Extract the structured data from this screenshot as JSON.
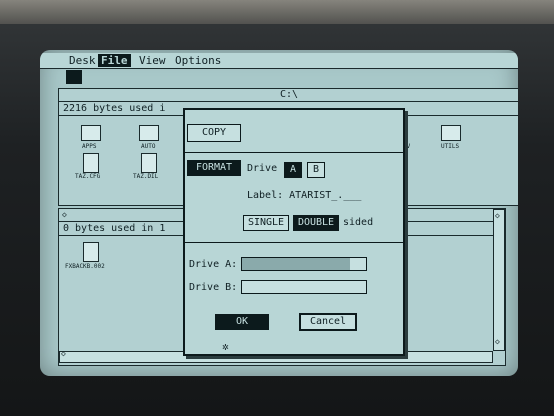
{
  "menu": {
    "desk": "Desk",
    "file": "File",
    "view": "View",
    "options": "Options"
  },
  "window_top": {
    "title": "C:\\",
    "info": "2216 bytes used i",
    "icons": [
      "APPS",
      "AUTO",
      "TAZ.CFG",
      "TAZ.DIL",
      "UTILS"
    ],
    "partial_label": "PV"
  },
  "window_bottom": {
    "info": "0 bytes used in 1",
    "icons": [
      "FXBACKB.002"
    ]
  },
  "dialog": {
    "copy": "COPY",
    "format": "FORMAT",
    "drive_label": "Drive",
    "drive_a": "A",
    "drive_b": "B",
    "label_field": "Label: ATARIST_.___",
    "single": "SINGLE",
    "double": "DOUBLE",
    "sided": "sided",
    "drive_a_progress_label": "Drive A:",
    "drive_b_progress_label": "Drive B:",
    "drive_a_progress": 0.87,
    "drive_b_progress": 0,
    "ok": "OK",
    "cancel": "Cancel"
  }
}
